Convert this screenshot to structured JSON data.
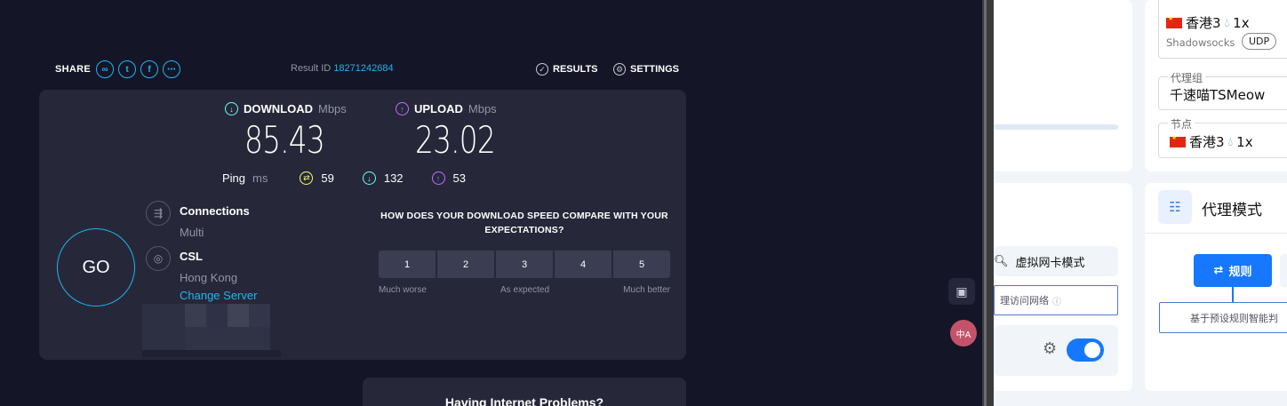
{
  "speedtest": {
    "share_label": "SHARE",
    "result_id_label": "Result ID",
    "result_id": "18271242684",
    "results_label": "RESULTS",
    "settings_label": "SETTINGS",
    "download": {
      "label": "DOWNLOAD",
      "unit": "Mbps",
      "value": "85.43"
    },
    "upload": {
      "label": "UPLOAD",
      "unit": "Mbps",
      "value": "23.02"
    },
    "ping": {
      "label": "Ping",
      "unit": "ms",
      "idle": "59",
      "download": "132",
      "upload": "53"
    },
    "go_label": "GO",
    "connections": {
      "title": "Connections",
      "value": "Multi"
    },
    "server": {
      "title": "CSL",
      "location": "Hong Kong",
      "change_label": "Change Server"
    },
    "question": "HOW DOES YOUR DOWNLOAD SPEED COMPARE WITH YOUR EXPECTATIONS?",
    "ratings": [
      "1",
      "2",
      "3",
      "4",
      "5"
    ],
    "rating_labels": {
      "low": "Much worse",
      "mid": "As expected",
      "high": "Much better"
    },
    "problems_title": "Having Internet Problems?"
  },
  "side_icons": {
    "translate_label": "中A"
  },
  "clash": {
    "top_node": {
      "name": "香港3",
      "multiplier": "1x",
      "protocol": "Shadowsocks",
      "udp_label": "UDP"
    },
    "proxy_group": {
      "legend": "代理组",
      "value": "千速喵TSMeow"
    },
    "node": {
      "legend": "节点",
      "name": "香港3",
      "multiplier": "1x"
    },
    "mode": {
      "title": "代理模式",
      "rule_label": "规则",
      "description": "基于预设规则智能判"
    },
    "vnic_label": "虚拟网卡模式",
    "vnic_hint": "理访问网络",
    "accent": "#1677ff"
  }
}
